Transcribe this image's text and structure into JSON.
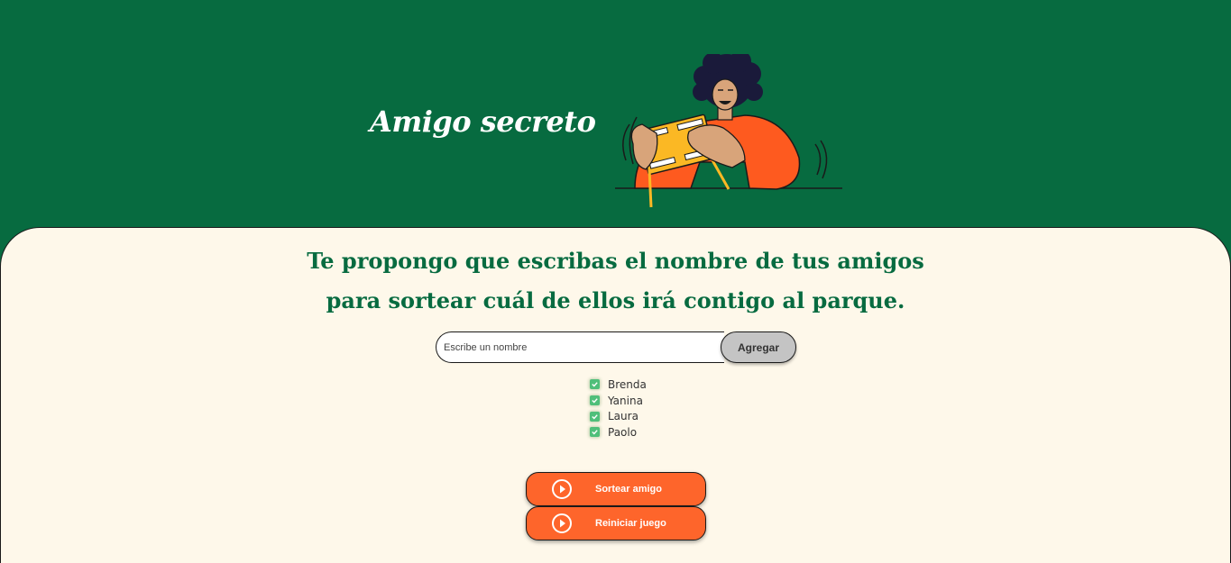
{
  "header": {
    "title": "Amigo secreto",
    "illustration_icon": "person-with-gift-illustration"
  },
  "main": {
    "subtitle_line1": "Te propongo que escribas el nombre de tus amigos",
    "subtitle_line2": "para sortear cuál de ellos irá contigo al parque.",
    "input": {
      "placeholder": "Escribe un nombre",
      "value": ""
    },
    "add_button_label": "Agregar",
    "friends": [
      "Brenda",
      "Yanina",
      "Laura",
      "Paolo"
    ],
    "draw_button_label": "Sortear amigo",
    "reset_button_label": "Reiniciar juego"
  },
  "colors": {
    "primary_green": "#076b40",
    "cream": "#fef8ea",
    "accent_orange": "#fe652b",
    "button_gray": "#c4c4c4",
    "check_green": "#4fbf7a"
  }
}
